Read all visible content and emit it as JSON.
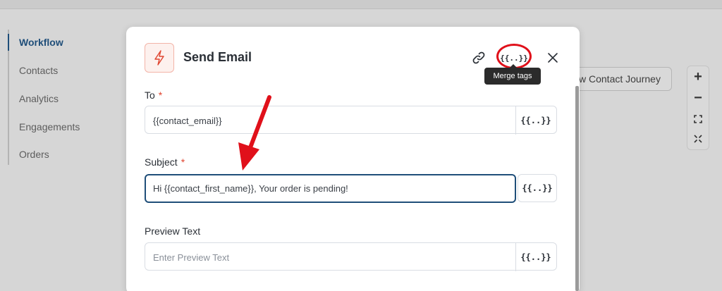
{
  "sidebar": {
    "items": [
      {
        "label": "Workflow",
        "active": true
      },
      {
        "label": "Contacts",
        "active": false
      },
      {
        "label": "Analytics",
        "active": false
      },
      {
        "label": "Engagements",
        "active": false
      },
      {
        "label": "Orders",
        "active": false
      }
    ]
  },
  "background": {
    "journey_button_label": "w Contact Journey",
    "zoom_in_symbol": "+",
    "zoom_out_symbol": "−"
  },
  "modal": {
    "title": "Send Email",
    "icons": {
      "action": "lightning-icon",
      "link": "link-icon",
      "merge": "merge-tags-icon",
      "close": "close-icon"
    },
    "merge_tag_symbol": "{{..}}",
    "tooltip": "Merge tags",
    "close_symbol": "✕",
    "fields": {
      "to": {
        "label": "To",
        "required_mark": "*",
        "value": "{{contact_email}}"
      },
      "subject": {
        "label": "Subject",
        "required_mark": "*",
        "value": "Hi {{contact_first_name}}, Your order is pending!"
      },
      "preview": {
        "label": "Preview Text",
        "value": "",
        "placeholder": "Enter Preview Text"
      }
    }
  },
  "colors": {
    "accent": "#1f4e79",
    "required": "#e0442f",
    "annotation": "#e0101a"
  }
}
